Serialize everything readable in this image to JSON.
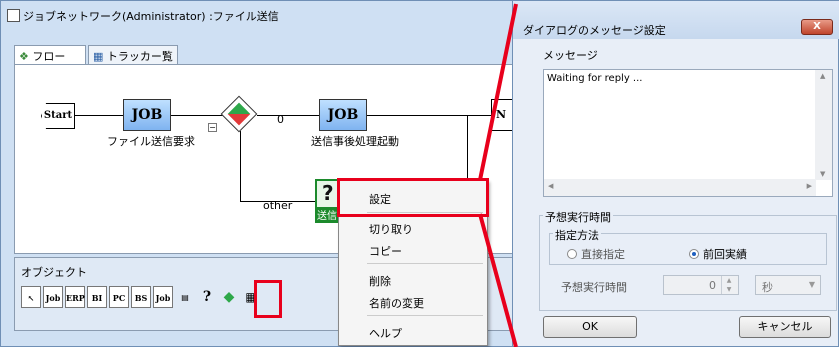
{
  "back_window": {
    "title": "ジョブネットワーク(Administrator) :ファイル送信",
    "tabs": [
      {
        "label": "フロー",
        "icon": "flow-icon"
      },
      {
        "label": "トラッカー覧",
        "icon": "tracker-list-icon"
      }
    ]
  },
  "flow": {
    "start_label": "Start",
    "job1": {
      "box": "JOB",
      "label": "ファイル送信要求"
    },
    "branch_zero": "0",
    "job2": {
      "box": "JOB",
      "label": "送信事後処理起動"
    },
    "branch_other": "other",
    "end_partial": "N",
    "collapse_glyph": "−",
    "dialog_node_partial": "送信"
  },
  "objects_panel": {
    "title": "オブジェクト",
    "tools": [
      "Job",
      "ERP",
      "BI",
      "PC",
      "BS",
      "Job"
    ]
  },
  "context_menu": {
    "items": [
      "設定",
      "切り取り",
      "コピー",
      "削除",
      "名前の変更",
      "ヘルプ"
    ]
  },
  "dialog": {
    "title": "ダイアログのメッセージ設定",
    "close_label": "X",
    "message_label": "メッセージ",
    "message_value": "Waiting for reply ...",
    "expected_time_group": "予想実行時間",
    "method_label": "指定方法",
    "radio_direct": "直接指定",
    "radio_previous": "前回実績",
    "expected_time_label": "予想実行時間",
    "time_value": "0",
    "unit_value": "秒",
    "ok_label": "OK",
    "cancel_label": "キャンセル"
  },
  "colors": {
    "highlight": "#e8001c",
    "accent": "#1f5fbf"
  }
}
